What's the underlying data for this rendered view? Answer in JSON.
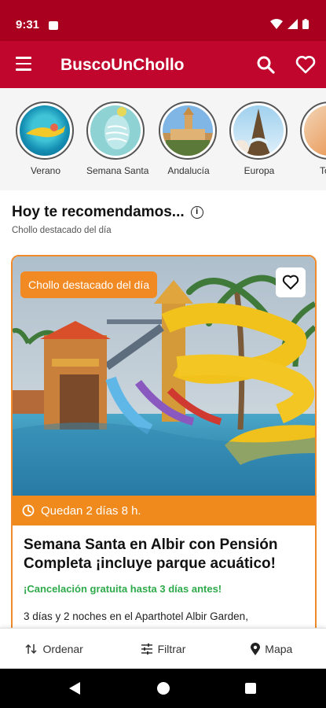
{
  "status_bar": {
    "time": "9:31"
  },
  "app_bar": {
    "title": "BuscoUnChollo"
  },
  "stories": [
    {
      "label": "Verano"
    },
    {
      "label": "Semana Santa"
    },
    {
      "label": "Andalucía"
    },
    {
      "label": "Europa"
    },
    {
      "label": "Todo"
    }
  ],
  "recommend": {
    "title": "Hoy te recomendamos...",
    "subtitle": "Chollo destacado del día"
  },
  "card": {
    "badge": "Chollo destacado del día",
    "countdown": "Quedan 2 días 8 h.",
    "title": "Semana Santa en Albir con Pensión Completa ¡incluye parque acuático!",
    "cancellation": "¡Cancelación gratuita hasta 3 días antes!",
    "description_prefix": "3 días y 2 noches en el",
    "description_hotel": "Aparthotel Albir Garden,"
  },
  "bottom_bar": {
    "sort_label": "Ordenar",
    "filter_label": "Filtrar",
    "map_label": "Mapa"
  },
  "colors": {
    "brand": "#c1062d",
    "accent_orange": "#f08a1c",
    "success_green": "#2eaa4a"
  }
}
